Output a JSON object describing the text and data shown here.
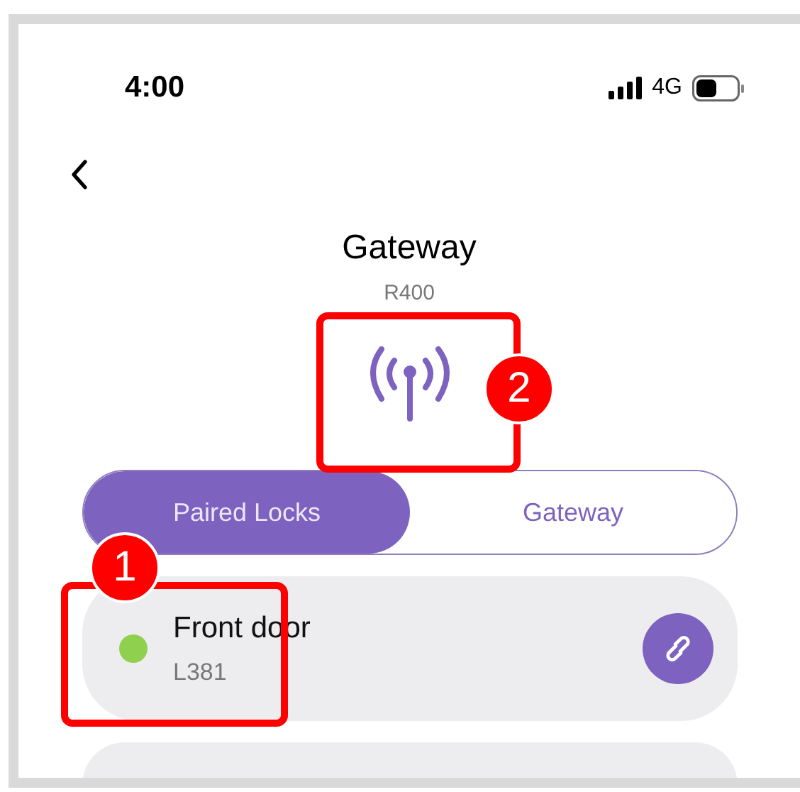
{
  "status_bar": {
    "time": "4:00",
    "network": "4G"
  },
  "header": {
    "title": "Gateway",
    "model": "R400"
  },
  "tabs": [
    {
      "label": "Paired Locks",
      "selected": true
    },
    {
      "label": "Gateway",
      "selected": false
    }
  ],
  "locks": [
    {
      "name": "Front door",
      "code": "L381",
      "color": "#8fd14f"
    }
  ],
  "callouts": [
    {
      "label": "1"
    },
    {
      "label": "2"
    }
  ]
}
